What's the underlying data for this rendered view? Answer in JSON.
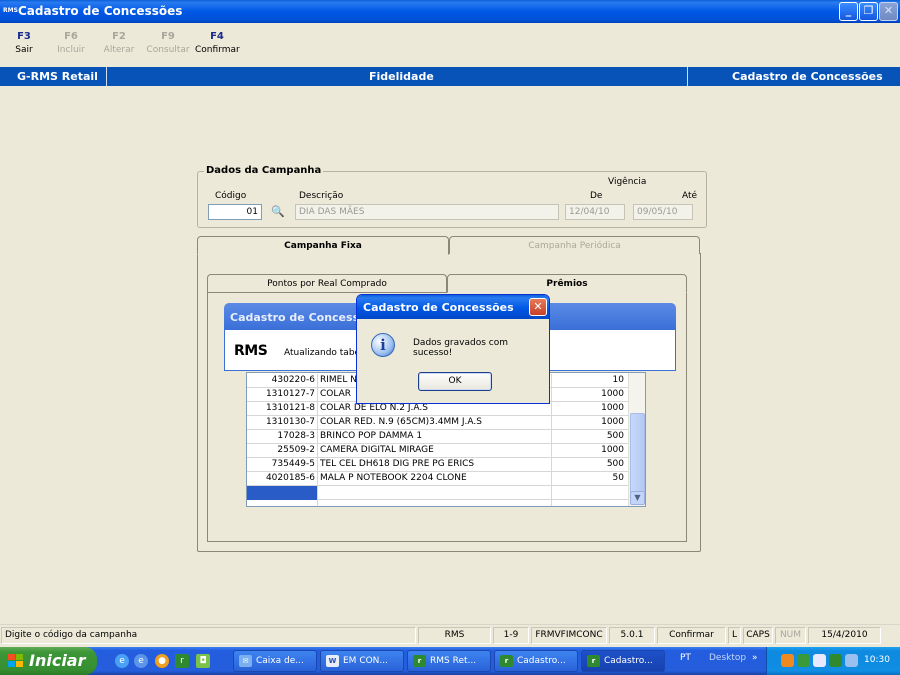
{
  "window": {
    "app_icon_text": "RMS",
    "title": "Cadastro de Concessões"
  },
  "toolbar": [
    {
      "key": "F3",
      "label": "Sair",
      "enabled": true
    },
    {
      "key": "F6",
      "label": "Incluir",
      "enabled": false
    },
    {
      "key": "F2",
      "label": "Alterar",
      "enabled": false
    },
    {
      "key": "F9",
      "label": "Consultar",
      "enabled": false
    },
    {
      "key": "F4",
      "label": "Confirmar",
      "enabled": true
    }
  ],
  "header_band": {
    "left": "G-RMS Retail",
    "center": "Fidelidade",
    "right": "Cadastro de Concessões"
  },
  "campaign": {
    "group_title": "Dados da Campanha",
    "codigo_label": "Código",
    "codigo_value": "01",
    "descricao_label": "Descrição",
    "descricao_value": "DIA DAS MÃES",
    "vigencia_label": "Vigência",
    "de_label": "De",
    "de_value": "12/04/10",
    "ate_label": "Até",
    "ate_value": "09/05/10"
  },
  "tabs": {
    "fixa": "Campanha Fixa",
    "periodica": "Campanha Periódica"
  },
  "subtabs": {
    "pontos": "Pontos por Real Comprado",
    "premios": "Prêmios"
  },
  "grid_rows": [
    {
      "code": "430220-6",
      "desc": "RIMEL N",
      "qty": "10"
    },
    {
      "code": "1310127-7",
      "desc": "COLAR",
      "qty": "1000"
    },
    {
      "code": "1310121-8",
      "desc": "COLAR DE ELO N.2 J.A.S",
      "qty": "1000"
    },
    {
      "code": "1310130-7",
      "desc": "COLAR RED. N.9 (65CM)3.4MM J.A.S",
      "qty": "1000"
    },
    {
      "code": "17028-3",
      "desc": "BRINCO POP DAMMA   1",
      "qty": "500"
    },
    {
      "code": "25509-2",
      "desc": "CAMERA DIGITAL MIRAGE",
      "qty": "1000"
    },
    {
      "code": "735449-5",
      "desc": "TEL CEL DH618 DIG PRE PG ERICS",
      "qty": "500"
    },
    {
      "code": "4020185-6",
      "desc": "MALA P NOTEBOOK 2204 CLONE",
      "qty": "50"
    }
  ],
  "progress_window": {
    "title": "Cadastro de Concessões",
    "logo": "RMS",
    "message": "Atualizando tabel"
  },
  "message_box": {
    "title": "Cadastro de Concessões",
    "icon": "info-icon",
    "message": "Dados gravados com sucesso!",
    "ok_label": "OK"
  },
  "statusbar": {
    "hint": "Digite o código da campanha",
    "system": "RMS",
    "range": "1-9",
    "form": "FRMVFIMCONC",
    "version": "5.0.1",
    "action": "Confirmar",
    "l": "L",
    "caps": "CAPS",
    "num": "NUM",
    "date": "15/4/2010"
  },
  "taskbar": {
    "start_label": "Iniciar",
    "tasks": [
      "Caixa de...",
      "EM CON...",
      "RMS Ret...",
      "Cadastro...",
      "Cadastro..."
    ],
    "lang": "PT",
    "desktop": "Desktop",
    "desktop_arrow": "»",
    "clock": "10:30"
  },
  "colors": {
    "accent_blue": "#0853b8",
    "titlebar_blue": "#0058e6",
    "start_green": "#3c9636"
  }
}
